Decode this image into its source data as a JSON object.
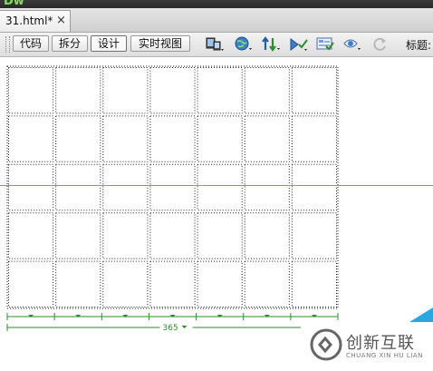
{
  "app": {
    "logo": "Dw"
  },
  "document_tab": {
    "title": "31.html*",
    "close_glyph": "×"
  },
  "toolbar": {
    "view_buttons": [
      "代码",
      "拆分",
      "设计",
      "实时视图"
    ],
    "active_view": "设计",
    "icons": [
      "multiscreen-icon",
      "browser-preview-icon",
      "file-management-icon",
      "w3c-validation-icon",
      "visual-aids-icon",
      "preview-options-icon",
      "refresh-icon"
    ],
    "title_label": "标题:"
  },
  "table": {
    "columns": 7,
    "rows": 5,
    "width_label": "365"
  },
  "colors": {
    "guide_line": "#f07050",
    "width_indicator": "#2e8b2e",
    "accent": "#2aa7e0"
  },
  "watermark": {
    "brand_cn": "创新互联",
    "brand_en": "CHUANG XIN HU LIAN"
  }
}
